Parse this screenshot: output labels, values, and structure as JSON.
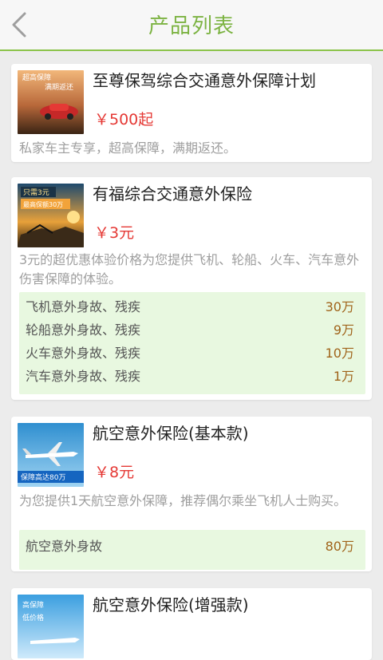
{
  "header": {
    "title": "产品列表",
    "back_icon": "chevron-left-icon"
  },
  "products": [
    {
      "name": "至尊保驾综合交通意外保障计划",
      "price": "￥500起",
      "description": "私家车主专享，超高保障，满期返还。",
      "thumb_text": [
        "超高保障",
        "满期返还"
      ]
    },
    {
      "name": "有福综合交通意外保险",
      "price": "￥3元",
      "description": "3元的超优惠体验价格为您提供飞机、轮船、火车、汽车意外伤害保障的体验。",
      "thumb_text": [
        "只需3元",
        "最高保额30万"
      ],
      "coverage": [
        {
          "item": "飞机意外身故、残疾",
          "amount": "30万"
        },
        {
          "item": "轮船意外身故、残疾",
          "amount": "9万"
        },
        {
          "item": "火车意外身故、残疾",
          "amount": "10万"
        },
        {
          "item": "汽车意外身故、残疾",
          "amount": "1万"
        }
      ]
    },
    {
      "name": "航空意外保险(基本款)",
      "price": "￥8元",
      "description": "为您提供1天航空意外保障，推荐偶尔乘坐飞机人士购买。",
      "thumb_text": [
        "保障高达80万"
      ],
      "coverage": [
        {
          "item": "航空意外身故",
          "amount": "80万"
        }
      ]
    },
    {
      "name": "航空意外保险(增强款)",
      "price": "",
      "description": "",
      "thumb_text": [
        "高保障",
        "低价格"
      ]
    }
  ],
  "colors": {
    "accent": "#7cb342",
    "price": "#e53935",
    "amount": "#a0631a",
    "coverage_bg": "#e8f8e0"
  }
}
